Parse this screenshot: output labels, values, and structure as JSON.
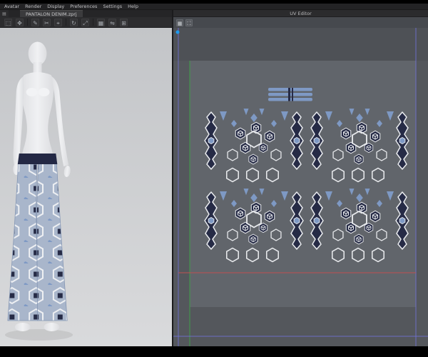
{
  "menubar": {
    "items": [
      "Avatar",
      "Render",
      "Display",
      "Preferences",
      "Settings",
      "Help"
    ]
  },
  "tabbar": {
    "active_tab": "PANTALON DENIM.zprj",
    "document_icon_glyph": "▤"
  },
  "toolbar": {
    "icons": [
      {
        "name": "select-tool",
        "glyph": "⬚"
      },
      {
        "name": "move-tool",
        "glyph": "✥"
      },
      {
        "name": "pen-tool",
        "glyph": "✎"
      },
      {
        "name": "cut-tool",
        "glyph": "✂"
      },
      {
        "name": "pin-tool",
        "glyph": "⌖"
      },
      {
        "name": "rotate-tool",
        "glyph": "↻"
      },
      {
        "name": "scale-tool",
        "glyph": "⤢"
      },
      {
        "name": "grid-tool",
        "glyph": "▦"
      },
      {
        "name": "mirror-tool",
        "glyph": "⇋"
      },
      {
        "name": "add-tool",
        "glyph": "⊞"
      }
    ]
  },
  "uv_editor": {
    "title": "UV Editor",
    "icons": [
      {
        "name": "uv-grid",
        "glyph": "▦"
      },
      {
        "name": "uv-fit",
        "glyph": "⛶"
      }
    ]
  },
  "colors": {
    "accent_blue_dot": "#1d9bf0",
    "pattern_navy": "#262b46",
    "pattern_steel_blue": "#7e99c4",
    "pattern_outline_white": "#e9ebee",
    "uv_guide_green": "#3f9e4a",
    "uv_guide_red": "#c05050",
    "uv_guide_purple": "#7070d8",
    "canvas_gray": "#54575c",
    "viewport_light": "#d0d1d3"
  }
}
